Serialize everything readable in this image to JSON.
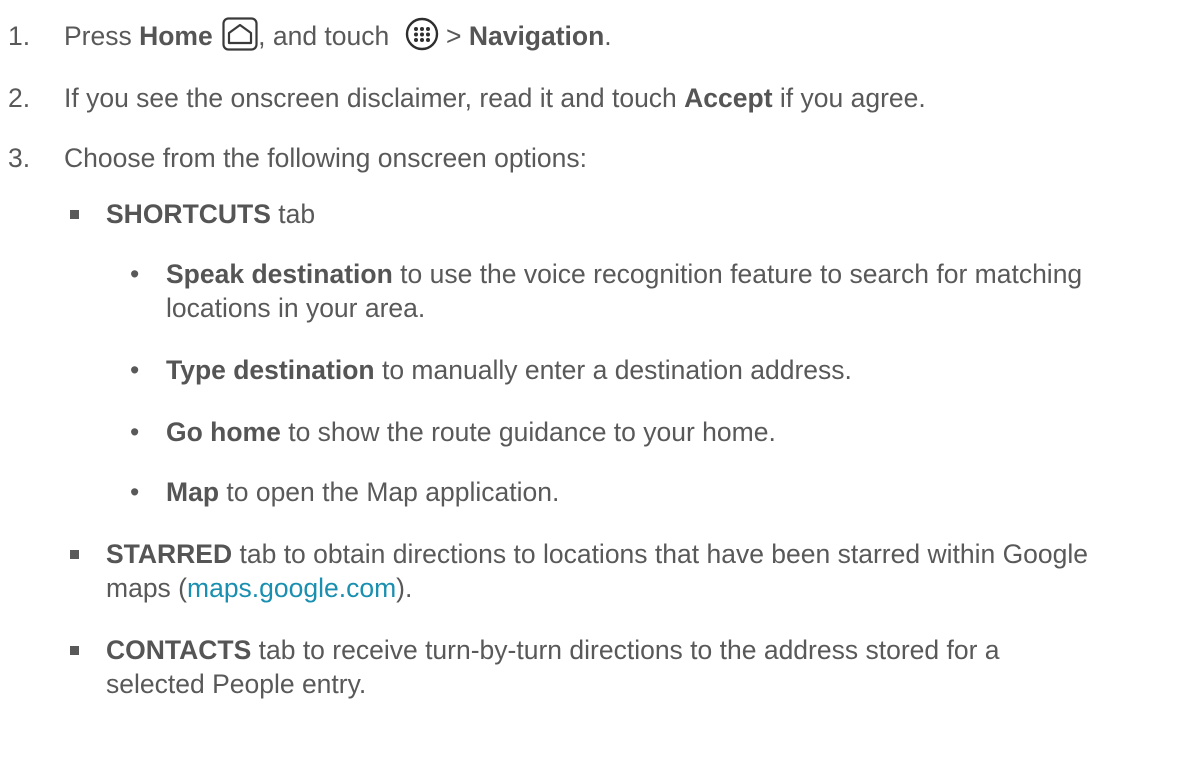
{
  "steps": [
    {
      "num": "1.",
      "text_a": "Press ",
      "bold_a": "Home",
      "text_b": ", and touch ",
      "text_c": " > ",
      "bold_b": "Navigation",
      "text_d": "."
    },
    {
      "num": "2.",
      "text_a": "If you see the onscreen disclaimer, read it and touch ",
      "bold_a": "Accept",
      "text_b": " if you agree."
    },
    {
      "num": "3.",
      "text_a": "Choose from the following onscreen options:"
    }
  ],
  "options": [
    {
      "bold": "SHORTCUTS",
      "text": " tab"
    },
    {
      "bold": "STARRED",
      "text_line1": " tab to obtain directions to locations that have been starred within Google",
      "text_line2_a": "maps (",
      "link": "maps.google.com",
      "text_line2_b": ")."
    },
    {
      "bold": "CONTACTS",
      "text_line1": " tab to receive turn-by-turn directions to the address stored for a",
      "text_line2": "selected People entry."
    }
  ],
  "shortcuts": [
    {
      "bullet": "•",
      "bold": "Speak destination",
      "text_line1": " to use the voice recognition feature to search for matching",
      "text_line2": "locations in your area."
    },
    {
      "bullet": "•",
      "bold": "Type destination",
      "text": " to manually enter a destination address."
    },
    {
      "bullet": "•",
      "bold": "Go home",
      "text": " to show the route guidance to your home."
    },
    {
      "bullet": "•",
      "bold": "Map",
      "text": " to open the Map application."
    }
  ],
  "icons": {
    "home": "home-icon",
    "apps": "apps-icon"
  }
}
